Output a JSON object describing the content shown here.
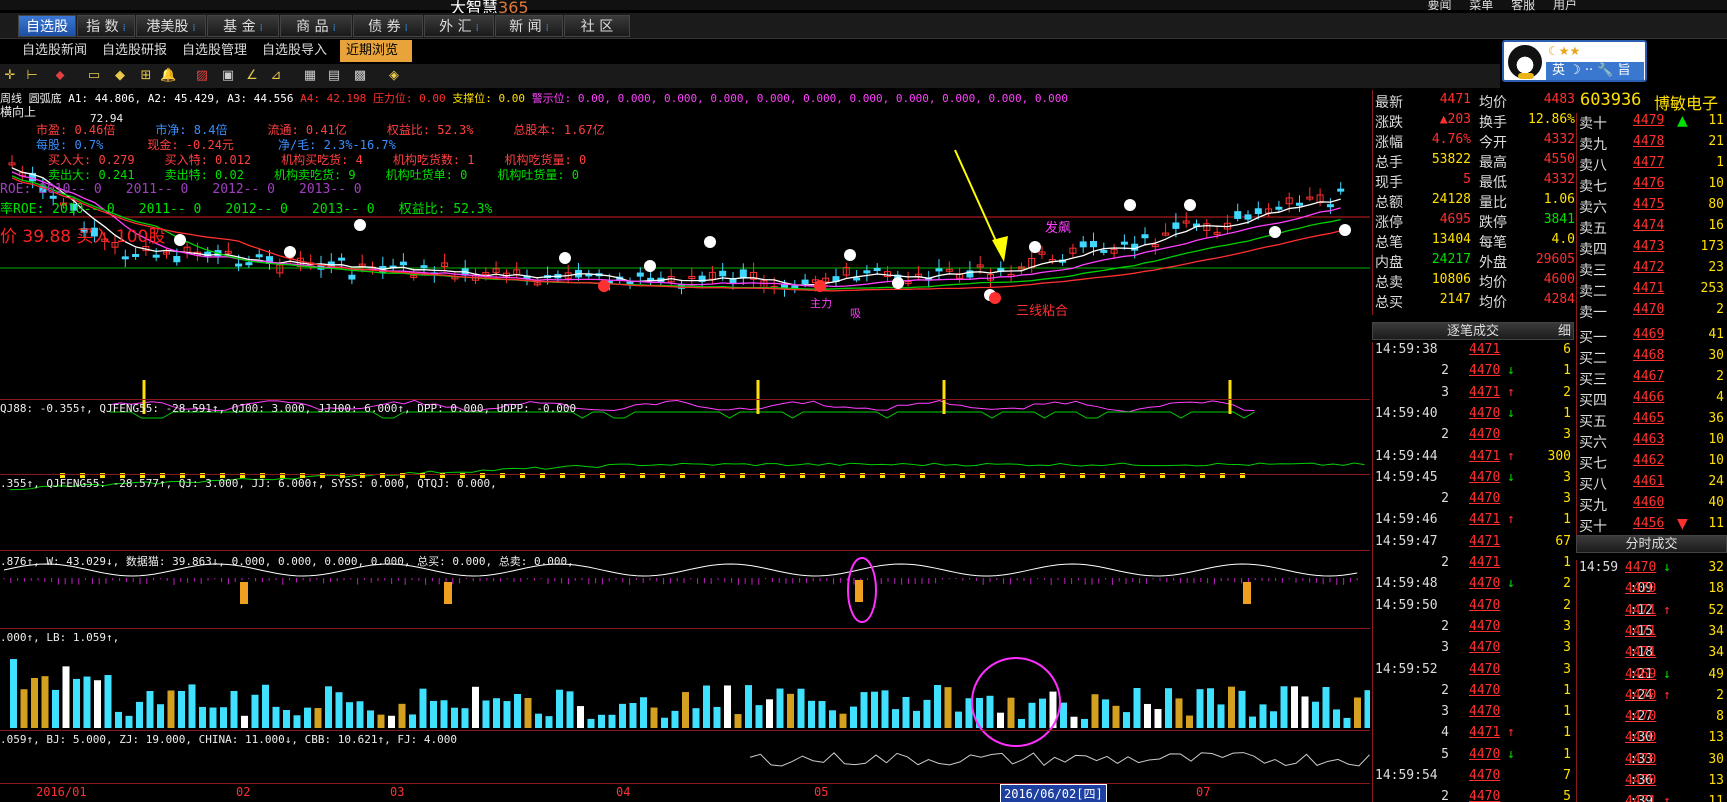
{
  "titlebar": {
    "brand": "大智慧",
    "brand_num": "365",
    "menu": [
      "要闻",
      "菜单",
      "客服",
      "用户"
    ]
  },
  "nav": [
    {
      "label": "自选股",
      "active": true
    },
    {
      "label": "指 数"
    },
    {
      "label": "港美股"
    },
    {
      "label": "基 金"
    },
    {
      "label": "商 品"
    },
    {
      "label": "债 券"
    },
    {
      "label": "外 汇"
    },
    {
      "label": "新 闻"
    },
    {
      "label": "社 区"
    }
  ],
  "subnav": [
    "自选股新闻",
    "自选股研报",
    "自选股管理",
    "自选股导入",
    "近期浏览"
  ],
  "im": {
    "stars": "☾★★",
    "bar": "英 ☽ ·· 🔧 旨"
  },
  "chart": {
    "main_header": [
      "周线",
      "圆弧底",
      "A1: 44.806",
      "A2: 45.429",
      "A3: 44.556",
      "A4: 42.198",
      "压力位: 0.00",
      "支撑位: 0.00",
      "警示位: 0.00, 0.000, 0.000, 0.000, 0.000, 0.000, 0.000, 0.000, 0.000, 0.000, 0.000"
    ],
    "trend_label": "横向上",
    "price_label": "72.94",
    "info1": [
      "市盈: 0.46倍",
      "市净: 8.4倍",
      "流通: 0.41亿",
      "权益比: 52.3%",
      "总股本: 1.67亿"
    ],
    "info2": [
      "每股: 0.7%",
      "现金: -0.24元",
      "净/毛: 2.3%-16.7%"
    ],
    "info3": [
      "买入大: 0.279",
      "买入特: 0.012",
      "机构买吃货: 4",
      "机构吃货数: 1",
      "机构吃货量: 0"
    ],
    "info4": [
      "卖出大: 0.241",
      "卖出特: 0.02",
      "机构卖吃货: 9",
      "机构吐货单: 0",
      "机构吐货量: 0"
    ],
    "roe": [
      "ROE: 2010-- 0",
      "2011-- 0",
      "2012-- 0",
      "2013-- 0"
    ],
    "roe2": [
      "率ROE: 2010-- 0",
      "2011-- 0",
      "2012-- 0",
      "2013-- 0",
      "权益比: 52.3%"
    ],
    "buy_hint": "价  39.88  买入  100股",
    "labels": {
      "fapiao": "发飙",
      "sanxian": "三线粘合",
      "zhuli": "主力",
      "xi": "吸"
    },
    "sub1_header": "QJ88: -0.355↑, QJFENG55: -28.591↑, QJ00: 3.000, JJJ00: 6.000↑, DPP: 0.000, UDPP: -0.000",
    "sub2_header": ".355↑, QJFENG55: -28.577↑, QJ: 3.000, JJ: 6.000↑, SYSS: 0.000, QTQJ: 0.000,",
    "sub3_header": ".876↑, W: 43.029↓, 数据猫: 39.863↓, 0.000, 0.000, 0.000, 0.000, 总买: 0.000, 总卖: 0.000,",
    "sub4_header": ".000↑, LB: 1.059↑,",
    "sub5_header": ".059↑, BJ: 5.000, ZJ: 19.000, CHINA: 11.000↓, CBB: 10.621↑, FJ: 4.000",
    "x_axis": [
      "2016/01",
      "02",
      "03",
      "04",
      "05",
      "2016/06/02[四]",
      "07"
    ]
  },
  "stock": {
    "code": "603936",
    "name": "博敏电子"
  },
  "quote": [
    {
      "l1": "最新",
      "v1": "4471",
      "c1": "red",
      "l2": "均价",
      "v2": "4483",
      "c2": "red"
    },
    {
      "l1": "涨跌",
      "v1": "▲203",
      "c1": "red",
      "l2": "换手",
      "v2": "12.86%",
      "c2": "yellow"
    },
    {
      "l1": "涨幅",
      "v1": "4.76%",
      "c1": "red",
      "l2": "今开",
      "v2": "4332",
      "c2": "red"
    },
    {
      "l1": "总手",
      "v1": "53822",
      "c1": "yellow",
      "l2": "最高",
      "v2": "4550",
      "c2": "red"
    },
    {
      "l1": "现手",
      "v1": "5",
      "c1": "red",
      "l2": "最低",
      "v2": "4332",
      "c2": "red"
    },
    {
      "l1": "总额",
      "v1": "24128",
      "c1": "yellow",
      "l2": "量比",
      "v2": "1.06",
      "c2": "yellow"
    },
    {
      "l1": "涨停",
      "v1": "4695",
      "c1": "red",
      "l2": "跌停",
      "v2": "3841",
      "c2": "green"
    },
    {
      "l1": "总笔",
      "v1": "13404",
      "c1": "yellow",
      "l2": "每笔",
      "v2": "4.0",
      "c2": "yellow"
    },
    {
      "l1": "内盘",
      "v1": "24217",
      "c1": "green",
      "l2": "外盘",
      "v2": "29605",
      "c2": "red"
    },
    {
      "l1": "总卖",
      "v1": "10806",
      "c1": "yellow",
      "l2": "均价",
      "v2": "4600",
      "c2": "red"
    },
    {
      "l1": "总买",
      "v1": "2147",
      "c1": "yellow",
      "l2": "均价",
      "v2": "4284",
      "c2": "red"
    }
  ],
  "book": [
    {
      "l": "卖十",
      "p": "4479",
      "c": "red",
      "v": "11",
      "m": "▲"
    },
    {
      "l": "卖九",
      "p": "4478",
      "c": "red",
      "v": "21"
    },
    {
      "l": "卖八",
      "p": "4477",
      "c": "red",
      "v": "1"
    },
    {
      "l": "卖七",
      "p": "4476",
      "c": "red",
      "v": "10"
    },
    {
      "l": "卖六",
      "p": "4475",
      "c": "red",
      "v": "80"
    },
    {
      "l": "卖五",
      "p": "4474",
      "c": "red",
      "v": "16"
    },
    {
      "l": "卖四",
      "p": "4473",
      "c": "red",
      "v": "173"
    },
    {
      "l": "卖三",
      "p": "4472",
      "c": "red",
      "v": "23"
    },
    {
      "l": "卖二",
      "p": "4471",
      "c": "red",
      "v": "253"
    },
    {
      "l": "卖一",
      "p": "4470",
      "c": "red",
      "v": "2"
    },
    {
      "l": "买一",
      "p": "4469",
      "c": "red",
      "v": "41"
    },
    {
      "l": "买二",
      "p": "4468",
      "c": "red",
      "v": "30"
    },
    {
      "l": "买三",
      "p": "4467",
      "c": "red",
      "v": "2"
    },
    {
      "l": "买四",
      "p": "4466",
      "c": "red",
      "v": "4"
    },
    {
      "l": "买五",
      "p": "4465",
      "c": "red",
      "v": "36"
    },
    {
      "l": "买六",
      "p": "4463",
      "c": "red",
      "v": "10"
    },
    {
      "l": "买七",
      "p": "4462",
      "c": "red",
      "v": "10"
    },
    {
      "l": "买八",
      "p": "4461",
      "c": "red",
      "v": "24"
    },
    {
      "l": "买九",
      "p": "4460",
      "c": "red",
      "v": "40"
    },
    {
      "l": "买十",
      "p": "4456",
      "c": "red",
      "v": "11",
      "m": "▼"
    }
  ],
  "tradeL_title": "逐笔成交",
  "tradeL_btn": "细",
  "tradeL": [
    {
      "t": "14:59:38",
      "p": "4471",
      "a": "",
      "v": "6"
    },
    {
      "t": "2",
      "p": "4470",
      "a": "↓",
      "v": "1"
    },
    {
      "t": "3",
      "p": "4471",
      "a": "↑",
      "v": "2"
    },
    {
      "t": "14:59:40",
      "p": "4470",
      "a": "↓",
      "v": "1"
    },
    {
      "t": "2",
      "p": "4470",
      "a": "",
      "v": "3"
    },
    {
      "t": "14:59:44",
      "p": "4471",
      "a": "↑",
      "v": "300"
    },
    {
      "t": "14:59:45",
      "p": "4470",
      "a": "↓",
      "v": "3"
    },
    {
      "t": "2",
      "p": "4470",
      "a": "",
      "v": "3"
    },
    {
      "t": "14:59:46",
      "p": "4471",
      "a": "↑",
      "v": "1"
    },
    {
      "t": "14:59:47",
      "p": "4471",
      "a": "",
      "v": "67"
    },
    {
      "t": "2",
      "p": "4471",
      "a": "",
      "v": "1"
    },
    {
      "t": "14:59:48",
      "p": "4470",
      "a": "↓",
      "v": "2"
    },
    {
      "t": "14:59:50",
      "p": "4470",
      "a": "",
      "v": "2"
    },
    {
      "t": "2",
      "p": "4470",
      "a": "",
      "v": "3"
    },
    {
      "t": "3",
      "p": "4470",
      "a": "",
      "v": "3"
    },
    {
      "t": "14:59:52",
      "p": "4470",
      "a": "",
      "v": "3"
    },
    {
      "t": "2",
      "p": "4470",
      "a": "",
      "v": "1"
    },
    {
      "t": "3",
      "p": "4470",
      "a": "",
      "v": "1"
    },
    {
      "t": "4",
      "p": "4471",
      "a": "↑",
      "v": "1"
    },
    {
      "t": "5",
      "p": "4470",
      "a": "↓",
      "v": "1"
    },
    {
      "t": "14:59:54",
      "p": "4470",
      "a": "",
      "v": "7"
    },
    {
      "t": "2",
      "p": "4470",
      "a": "",
      "v": "5"
    }
  ],
  "tradeR_title": "分时成交",
  "tradeR": [
    {
      "t": "14:59",
      "p": "4470",
      "a": "↓",
      "v": "32"
    },
    {
      "t": ":09",
      "p": "4470",
      "a": "",
      "v": "18"
    },
    {
      "t": ":12",
      "p": "4471",
      "a": "↑",
      "v": "52"
    },
    {
      "t": ":15",
      "p": "4471",
      "a": "",
      "v": "34"
    },
    {
      "t": ":18",
      "p": "4471",
      "a": "",
      "v": "34"
    },
    {
      "t": ":21",
      "p": "4469",
      "a": "↓",
      "v": "49"
    },
    {
      "t": ":24",
      "p": "4470",
      "a": "↑",
      "v": "2"
    },
    {
      "t": ":27",
      "p": "4470",
      "a": "",
      "v": "8"
    },
    {
      "t": ":30",
      "p": "4470",
      "a": "",
      "v": "13"
    },
    {
      "t": ":33",
      "p": "4470",
      "a": "",
      "v": "30"
    },
    {
      "t": ":36",
      "p": "4470",
      "a": "",
      "v": "13"
    },
    {
      "t": ":39",
      "p": "4471",
      "a": "↑",
      "v": "11"
    }
  ],
  "colors": {
    "up": "#ff3030",
    "down": "#00e000",
    "ma1": "#ffffff",
    "ma2": "#ff40ff",
    "ma3": "#00d000",
    "ma4": "#ff3030",
    "vol_up": "#40e0ff",
    "vol_gold": "#d4a020"
  }
}
